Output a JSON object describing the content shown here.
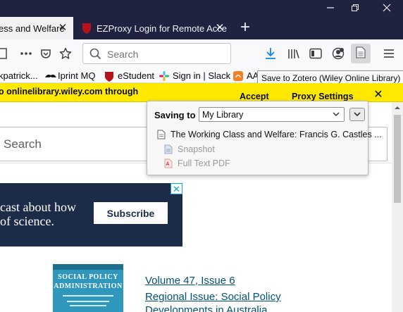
{
  "tabs": [
    {
      "label": "ess and Welfare",
      "close": "✕",
      "active": true
    },
    {
      "label": "EZProxy Login for Remote Acce",
      "close": "✕",
      "active": false
    }
  ],
  "new_tab_label": "+",
  "urlbar": {
    "placeholder": "Search"
  },
  "bookmarks": [
    {
      "label": "kpatrick...",
      "icon": "bookmark-icon"
    },
    {
      "label": "Iprint MQ",
      "icon": "mustache-icon"
    },
    {
      "label": "eStudent",
      "icon": "shield-icon"
    },
    {
      "label": "Sign in | Slack",
      "icon": "slack-icon"
    },
    {
      "label": "AA",
      "icon": "orange-icon"
    }
  ],
  "tooltip": "Save to Zotero (Wiley Online Library)",
  "notification": {
    "text": "o onlinelibrary.wiley.com through",
    "accept": "Accept",
    "proxy_settings": "Proxy Settings",
    "close": "✕"
  },
  "zotero": {
    "saving_label": "Saving to",
    "library": "My Library",
    "item_title": "The Working Class and Welfare: Francis G. Castles ...",
    "attachments": [
      "Snapshot",
      "Full Text PDF"
    ]
  },
  "page": {
    "search_placeholder": "Search",
    "ad_text_line1": "cast about how",
    "ad_text_line2": "of science.",
    "ad_button": "Subscribe",
    "ad_close": "✕",
    "cover": {
      "line1": "SOCIAL POLICY",
      "line2": "ADMINISTRATION"
    },
    "volume_label": "Volume",
    "volume_number": "47",
    "issue_label": "Issue",
    "issue_number": "6",
    "issue_separator": ",",
    "issue_title": "Regional Issue: Social Policy Developments in Australia"
  },
  "colors": {
    "tabbar": "#202340",
    "notification": "#ffe900",
    "ad_background": "#1c2c48",
    "link": "#005274",
    "cover": "#2f97bc",
    "download_arrow": "#0a84ff"
  }
}
